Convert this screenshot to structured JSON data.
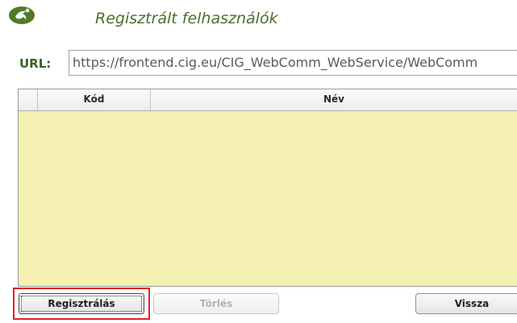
{
  "header": {
    "logo_icon": "running-figure-logo",
    "title": "Regisztrált felhasználók",
    "accent_color": "#4a6f2a"
  },
  "url_field": {
    "label": "URL:",
    "value": "https://frontend.cig.eu/CIG_WebComm_WebService/WebComm"
  },
  "grid": {
    "columns": [
      "",
      "Kód",
      "Név"
    ],
    "rows": [],
    "background": "#f3f0b2"
  },
  "buttons": {
    "register_label": "Regisztrálás",
    "delete_label": "Törlés",
    "back_label": "Vissza"
  }
}
